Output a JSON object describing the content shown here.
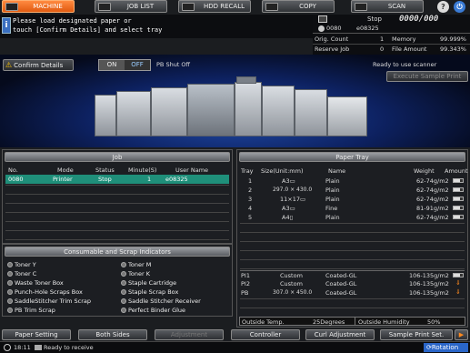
{
  "tabs": [
    {
      "label": "MACHINE"
    },
    {
      "label": "JOB LIST"
    },
    {
      "label": "HDD RECALL"
    },
    {
      "label": "COPY"
    },
    {
      "label": "SCAN"
    }
  ],
  "message": {
    "line1": "Please load designated paper or",
    "line2": "touch [Confirm Details] and select tray"
  },
  "status": {
    "state": "Stop",
    "counter": "0000/000",
    "job_no": "0080",
    "user": "e08325",
    "orig_count_label": "Orig. Count",
    "orig_count": "1",
    "memory_label": "Memory",
    "memory": "99.999%",
    "reserve_job_label": "Reserve Job",
    "reserve_job": "0",
    "file_amount_label": "File Amount",
    "file_amount": "99.343%"
  },
  "machine": {
    "confirm_details": "Confirm Details",
    "on": "ON",
    "off": "OFF",
    "pb_shutoff": "PB Shut Off",
    "ready_scanner": "Ready to use scanner",
    "execute_sample": "Execute Sample Print"
  },
  "job": {
    "title": "Job",
    "headers": [
      "No.",
      "Mode",
      "Status",
      "Minute(S)",
      "User Name"
    ],
    "rows": [
      {
        "no": "0080",
        "mode": "Printer",
        "status": "Stop",
        "minute": "1",
        "user": "e08325"
      }
    ]
  },
  "consumables": {
    "title": "Consumable and Scrap Indicators",
    "left": [
      "Toner Y",
      "Toner C",
      "Waste Toner Box",
      "Punch-Hole Scraps Box",
      "SaddleStitcher Trim Scrap",
      "PB Trim Scrap"
    ],
    "right": [
      "Toner M",
      "Toner K",
      "Staple Cartridge",
      "Staple Scrap Box",
      "Saddle Stitcher Receiver",
      "Perfect Binder Glue"
    ]
  },
  "paper_tray": {
    "title": "Paper Tray",
    "headers": [
      "Tray",
      "Size(Unit:mm)",
      "Name",
      "Weight",
      "Amount"
    ],
    "rows": [
      {
        "tray": "1",
        "size": "A3▭",
        "name": "Plain",
        "weight": "62-74g/m2"
      },
      {
        "tray": "2",
        "size": "297.0 × 430.0",
        "name": "Plain",
        "weight": "62-74g/m2"
      },
      {
        "tray": "3",
        "size": "11×17▭",
        "name": "Plain",
        "weight": "62-74g/m2"
      },
      {
        "tray": "4",
        "size": "A3▭",
        "name": "Fine",
        "weight": "81-91g/m2"
      },
      {
        "tray": "5",
        "size": "A4▯",
        "name": "Plain",
        "weight": "62-74g/m2"
      }
    ],
    "pi_rows": [
      {
        "tray": "PI1",
        "size": "Custom",
        "name": "Coated-GL",
        "weight": "106-135g/m2"
      },
      {
        "tray": "PI2",
        "size": "Custom",
        "name": "Coated-GL",
        "weight": "106-135g/m2"
      },
      {
        "tray": "PB",
        "size": "307.0 × 450.0",
        "name": "Coated-GL",
        "weight": "106-135g/m2"
      }
    ],
    "outside_temp_label": "Outside Temp.",
    "outside_temp": "25Degrees",
    "outside_humidity_label": "Outside Humidity",
    "outside_humidity": "50%"
  },
  "bottom": {
    "paper_setting": "Paper Setting",
    "both_sides": "Both Sides",
    "adjustment": "Adjustment",
    "controller": "Controller",
    "curl_adjustment": "Curl Adjustment",
    "sample_print_set": "Sample Print Set."
  },
  "footer": {
    "time": "18:11",
    "status": "Ready to receive",
    "rotation": "Rotation"
  },
  "colors": {
    "accent": "#e8661a",
    "selected_row": "#1f8f7a"
  }
}
